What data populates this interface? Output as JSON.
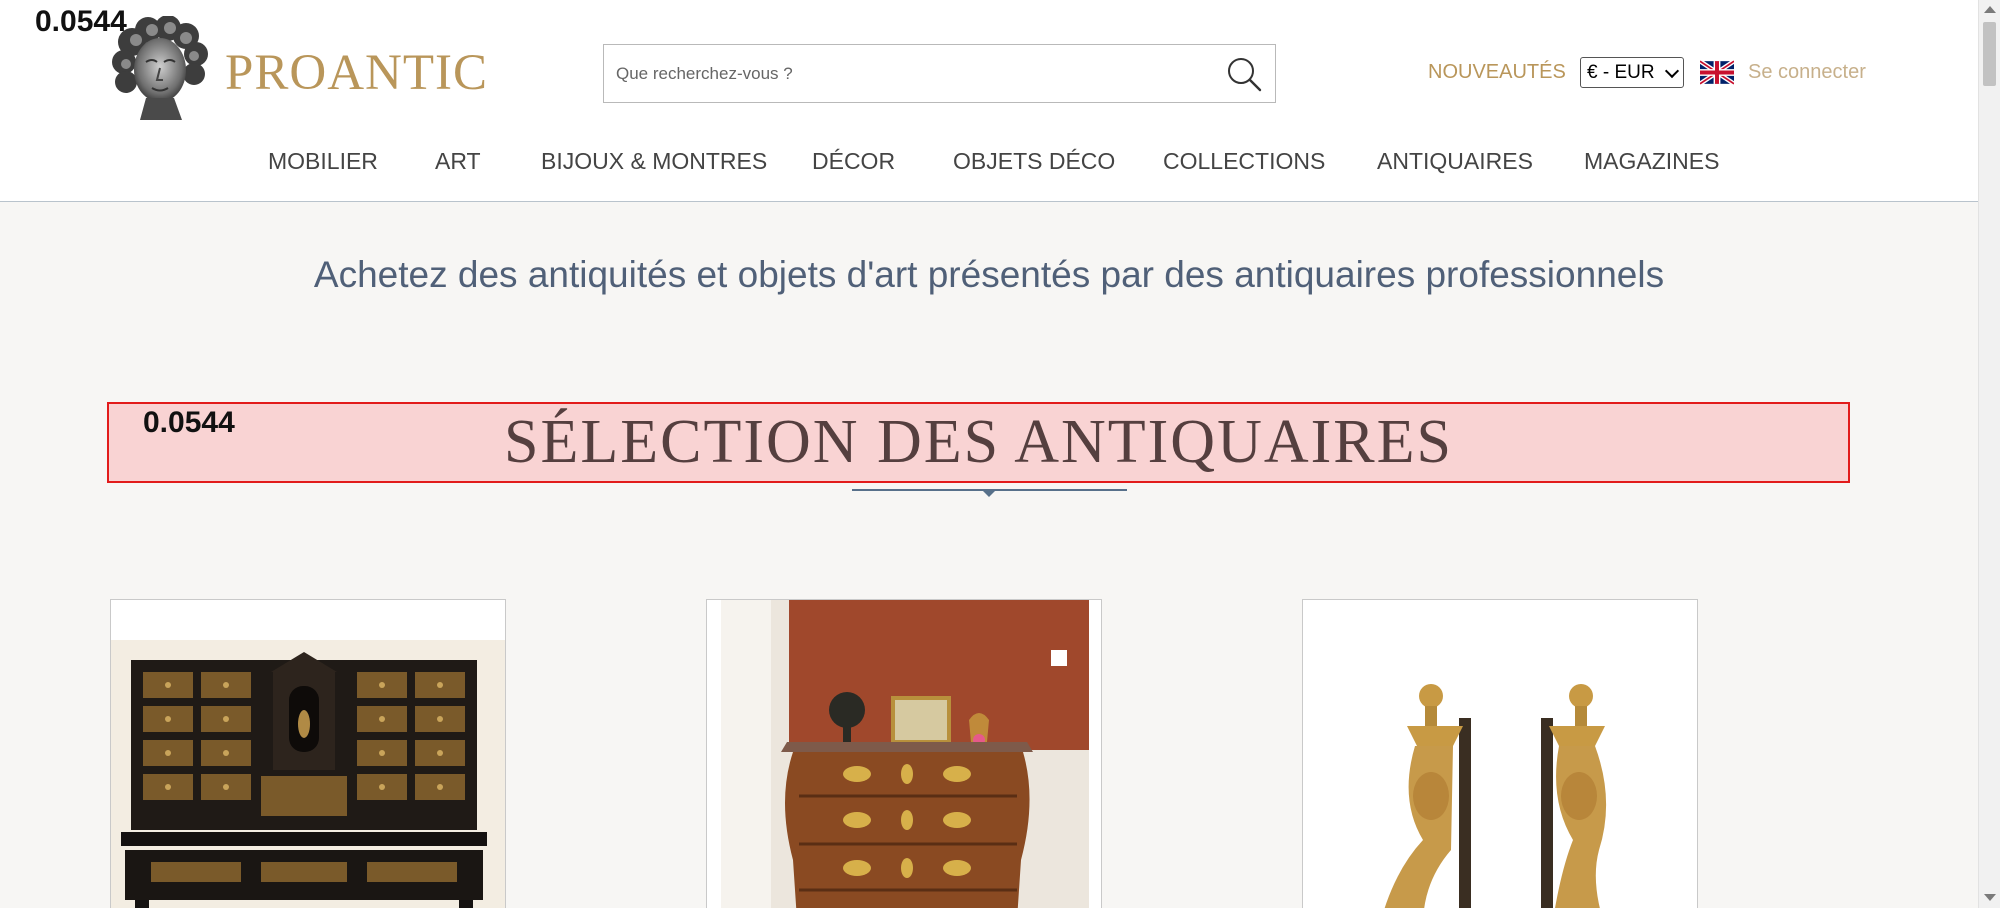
{
  "debug_score": "0.0544",
  "header": {
    "logo_text": "PROANTIC",
    "search": {
      "placeholder": "Que recherchez-vous ?"
    },
    "nouveautes_label": "NOUVEAUTÉS",
    "currency_value": "€ - EUR",
    "language_icon": "uk-flag-icon",
    "login_label": "Se connecter"
  },
  "nav": {
    "items": [
      {
        "label": "MOBILIER"
      },
      {
        "label": "ART"
      },
      {
        "label": "BIJOUX & MONTRES"
      },
      {
        "label": "DÉCOR"
      },
      {
        "label": "OBJETS DÉCO"
      },
      {
        "label": "COLLECTIONS"
      },
      {
        "label": "ANTIQUAIRES"
      },
      {
        "label": "MAGAZINES"
      }
    ]
  },
  "main": {
    "tagline": "Achetez des antiquités et objets d'art présentés par des antiquaires professionnels",
    "section_title": "SÉLECTION DES ANTIQUAIRES"
  },
  "colors": {
    "brand_gold": "#b9965a",
    "nav_text": "#444444",
    "tagline": "#506078",
    "highlight_fill": "#f9d3d3",
    "highlight_border": "#e21b1b"
  }
}
